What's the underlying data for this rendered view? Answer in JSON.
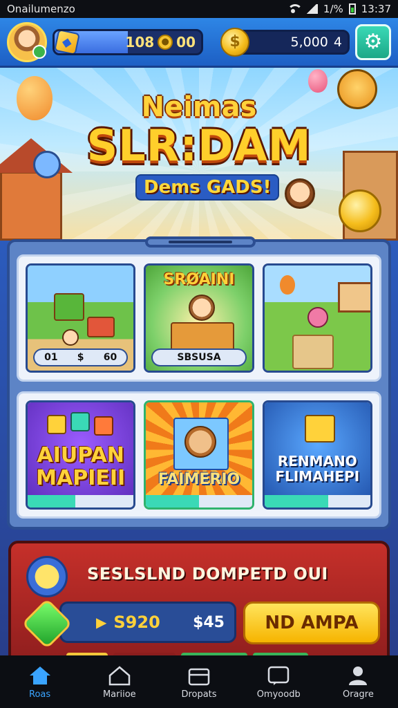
{
  "status_bar": {
    "carrier": "Onailumenzo",
    "battery_percent": "1/%",
    "time": "13:37"
  },
  "hud": {
    "gem_progress": 0.5,
    "gem_count": "108",
    "gem_suffix": "00",
    "coin_count": "5,000",
    "coin_suffix": "4",
    "colors": {
      "hud_blue": "#2e86e6",
      "settings_green": "#2ccfae",
      "coin_gold": "#f5bd1c"
    }
  },
  "hero": {
    "line1": "Neimas",
    "line2": "SLR:DAM",
    "line3": "Dems GADS!"
  },
  "cards_row1": [
    {
      "name": "card-village",
      "pill_left": "01",
      "pill_mid": "$",
      "pill_right": "60"
    },
    {
      "name": "card-crafting",
      "title": "SRØAINI",
      "pill_text": "SBSUSA"
    },
    {
      "name": "card-garden"
    }
  ],
  "cards_row2": [
    {
      "name": "card-aiupan",
      "line1": "AIUPAN",
      "line2": "MAPIEII",
      "progress": 0.45
    },
    {
      "name": "card-faimerio",
      "label": "FAIMERIO",
      "progress": 0.5
    },
    {
      "name": "card-renmano",
      "line1": "RENMANO",
      "line2": "FLIMAHEPI",
      "progress": 0.6
    }
  ],
  "promo": {
    "title": "SESLSLND DOMPETD OUI",
    "amount": "S920",
    "amount_alt": "$45",
    "button_label": "ND AMPA"
  },
  "bottom_nav": [
    {
      "label": "Roas",
      "icon": "home-icon",
      "active": true
    },
    {
      "label": "Mariioe",
      "icon": "map-icon",
      "active": false
    },
    {
      "label": "Dropats",
      "icon": "box-icon",
      "active": false
    },
    {
      "label": "Omyoodb",
      "icon": "chat-icon",
      "active": false
    },
    {
      "label": "Oragre",
      "icon": "profile-icon",
      "active": false
    }
  ]
}
